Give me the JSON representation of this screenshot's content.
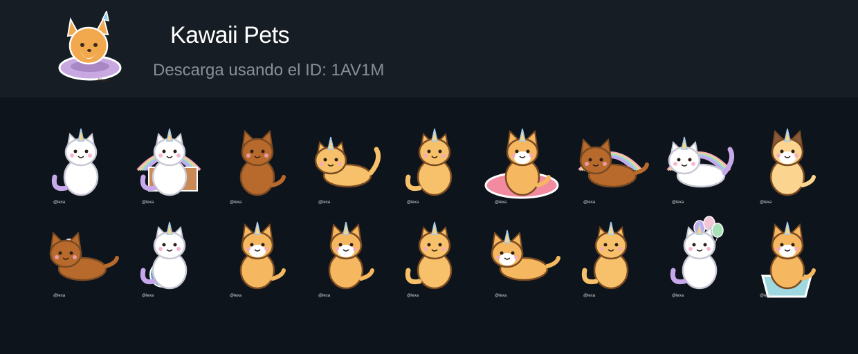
{
  "pack": {
    "title": "Kawaii Pets",
    "subtitle": "Descarga usando el ID: 1AV1M",
    "watermark": "@lexa"
  },
  "stickers": [
    {
      "name": "unicorn-cat-sitting-sticker",
      "animal": "cat",
      "fur": "#ffffff",
      "pose": "sit"
    },
    {
      "name": "unicorn-cat-in-box-sticker",
      "animal": "cat",
      "fur": "#ffffff",
      "pose": "box"
    },
    {
      "name": "dachshund-howling-sticker",
      "animal": "dog",
      "fur": "#b86a2c",
      "pose": "howl"
    },
    {
      "name": "unicorn-cat-lying-sticker",
      "animal": "cat",
      "fur": "#f7c06a",
      "pose": "lie"
    },
    {
      "name": "unicorn-cat-standing-sticker",
      "animal": "cat",
      "fur": "#f7c06a",
      "pose": "stand"
    },
    {
      "name": "corgi-on-pillow-sticker",
      "animal": "dog",
      "fur": "#f5b860",
      "pose": "pillow"
    },
    {
      "name": "dachshund-rainbow-sticker",
      "animal": "dog",
      "fur": "#b86a2c",
      "pose": "rainbow-lie"
    },
    {
      "name": "unicorn-cat-flying-rainbow-sticker",
      "animal": "cat",
      "fur": "#ffffff",
      "pose": "fly"
    },
    {
      "name": "unicorn-pug-sticker",
      "animal": "dog",
      "fur": "#fbd490",
      "pose": "pug"
    },
    {
      "name": "winged-dachshund-sticker",
      "animal": "dog",
      "fur": "#b86a2c",
      "pose": "wings"
    },
    {
      "name": "unicorn-cat-yarn-sticker",
      "animal": "cat",
      "fur": "#ffffff",
      "pose": "yarn"
    },
    {
      "name": "unicorn-corgi-sitting-sticker",
      "animal": "dog",
      "fur": "#f5b860",
      "pose": "sit"
    },
    {
      "name": "unicorn-corgi-sniffing-sticker",
      "animal": "dog",
      "fur": "#f5b860",
      "pose": "sniff"
    },
    {
      "name": "unicorn-cat-laughing-sticker",
      "animal": "cat",
      "fur": "#f7c06a",
      "pose": "laugh"
    },
    {
      "name": "unicorn-corgi-walking-sticker",
      "animal": "dog",
      "fur": "#f5b860",
      "pose": "walk"
    },
    {
      "name": "unicorn-cat-orange-sticker",
      "animal": "cat",
      "fur": "#f7c06a",
      "pose": "sit"
    },
    {
      "name": "unicorn-cat-balloons-sticker",
      "animal": "cat",
      "fur": "#ffffff",
      "pose": "balloons"
    },
    {
      "name": "unicorn-corgi-bowl-sticker",
      "animal": "dog",
      "fur": "#f5b860",
      "pose": "bowl"
    }
  ]
}
